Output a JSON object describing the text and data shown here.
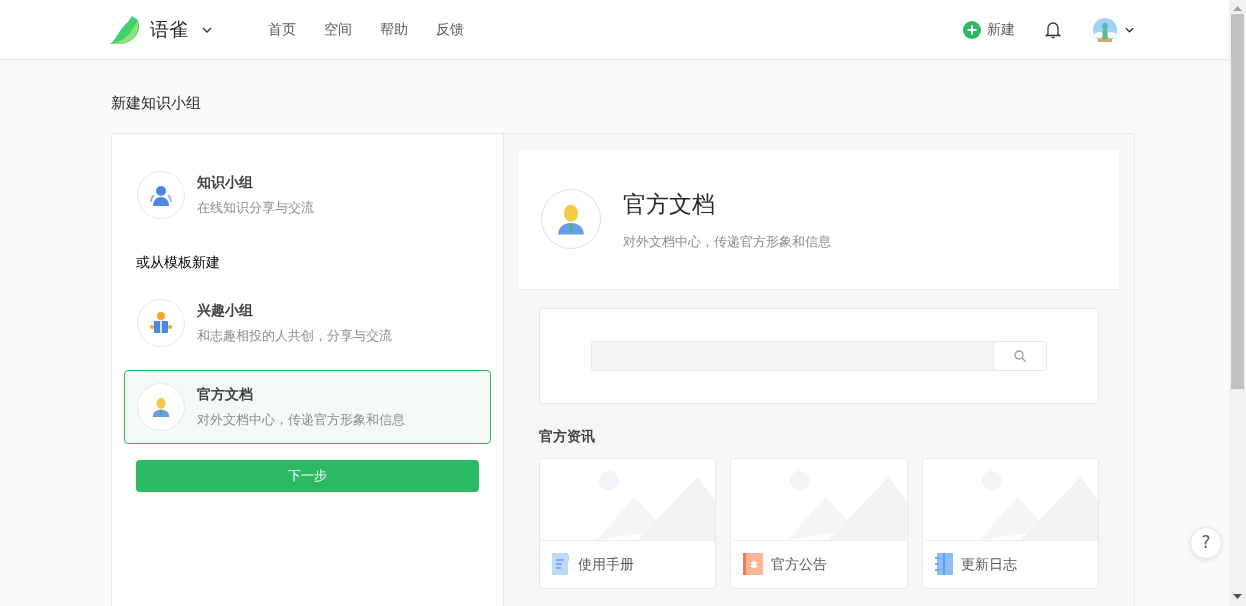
{
  "header": {
    "brand": "语雀",
    "nav": [
      {
        "label": "首页"
      },
      {
        "label": "空间"
      },
      {
        "label": "帮助"
      },
      {
        "label": "反馈"
      }
    ],
    "new_button": "新建"
  },
  "page_title": "新建知识小组",
  "options": [
    {
      "kind": "team",
      "title": "知识小组",
      "desc": "在线知识分享与交流",
      "selected": false
    }
  ],
  "template_heading": "或从模板新建",
  "templates": [
    {
      "kind": "reader",
      "title": "兴趣小组",
      "desc": "和志趣相投的人共创，分享与交流",
      "selected": false
    },
    {
      "kind": "official",
      "title": "官方文档",
      "desc": "对外文档中心，传递官方形象和信息",
      "selected": true
    }
  ],
  "next_button": "下一步",
  "preview": {
    "title": "官方文档",
    "desc": "对外文档中心，传递官方形象和信息",
    "section_title": "官方资讯",
    "cards": [
      {
        "kind": "manual",
        "label": "使用手册"
      },
      {
        "kind": "notice",
        "label": "官方公告"
      },
      {
        "kind": "log",
        "label": "更新日志"
      }
    ]
  },
  "help_button": "?"
}
